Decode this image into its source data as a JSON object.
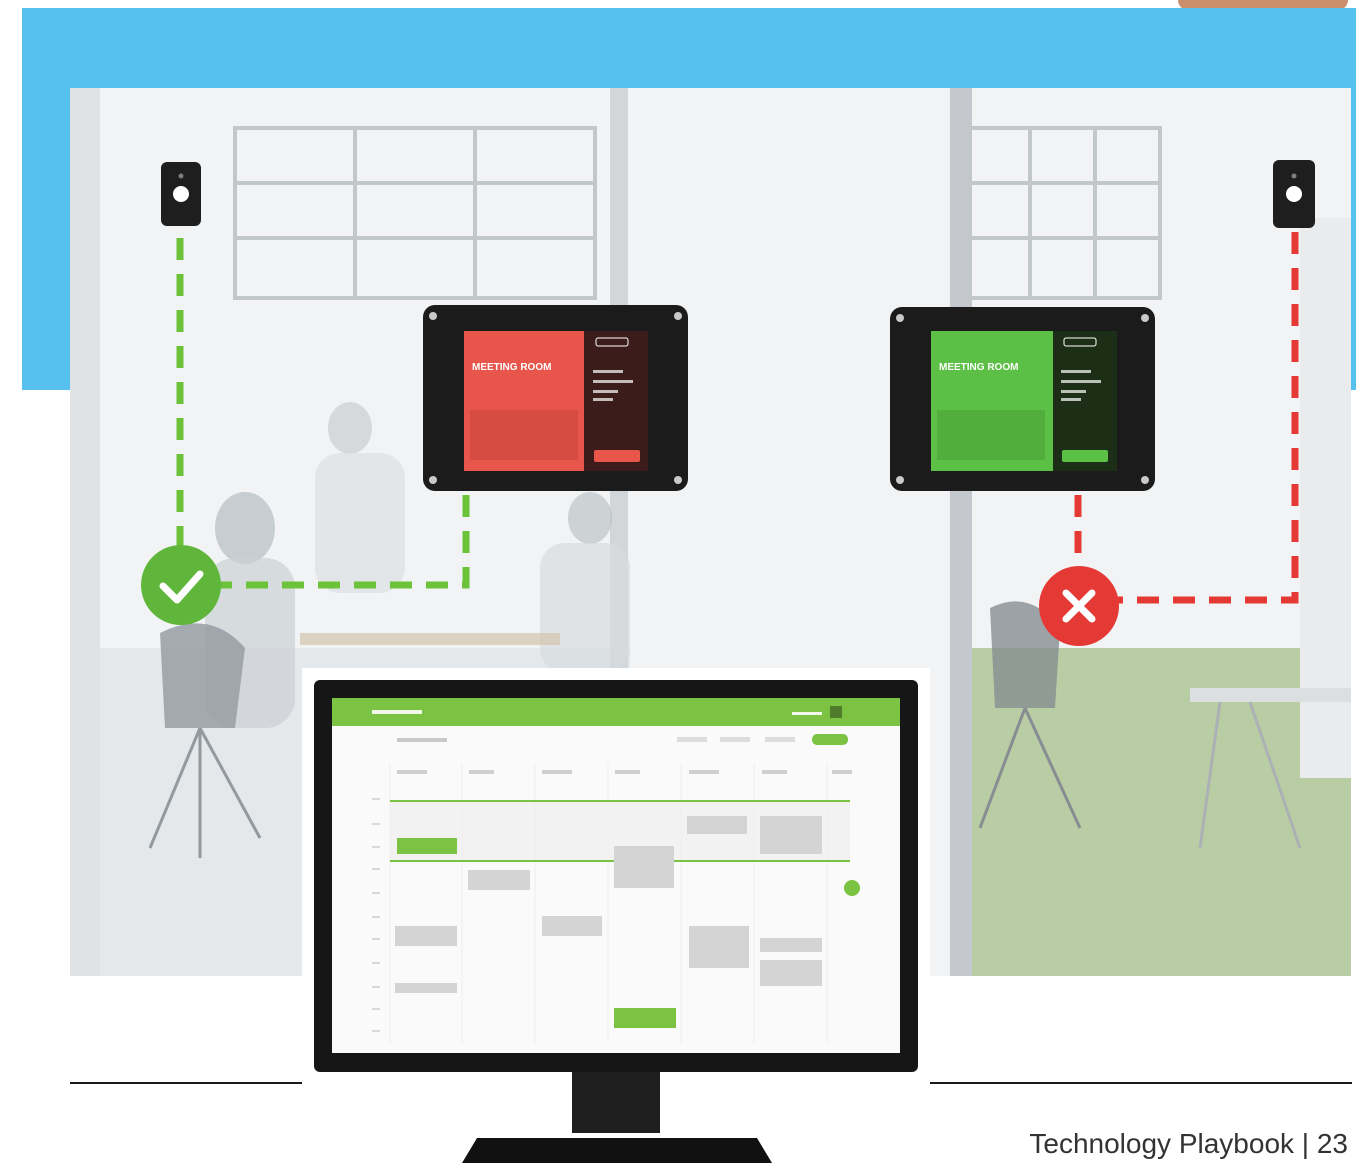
{
  "page": {
    "footer_text": "Technology Playbook | 23"
  },
  "tablets": [
    {
      "state": "occupied",
      "title": "MEETING ROOM",
      "accent": "#e8564b"
    },
    {
      "state": "available",
      "title": "MEETING ROOM",
      "accent": "#5cbf46"
    }
  ],
  "status_icons": [
    {
      "icon": "check-icon",
      "color": "#5fb63a"
    },
    {
      "icon": "close-icon",
      "color": "#e53935"
    }
  ],
  "colors": {
    "brand_blue": "#56c1ee",
    "dash_green": "#6cc33a",
    "dash_red": "#e53935",
    "ui_green": "#7cc243"
  }
}
